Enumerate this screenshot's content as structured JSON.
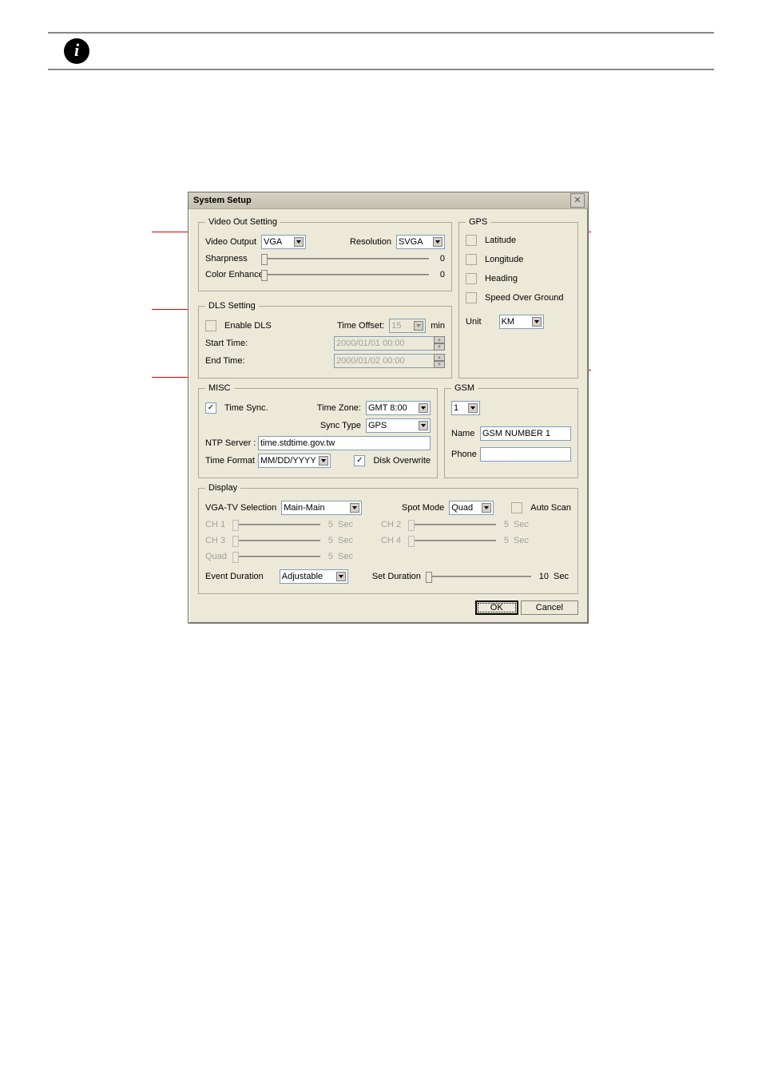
{
  "dialog": {
    "title": "System Setup",
    "video_out": {
      "legend": "Video Out Setting",
      "video_output_label": "Video Output",
      "video_output_value": "VGA",
      "resolution_label": "Resolution",
      "resolution_value": "SVGA",
      "sharpness_label": "Sharpness",
      "sharpness_value": "0",
      "color_enhance_label": "Color Enhance",
      "color_enhance_value": "0"
    },
    "gps": {
      "legend": "GPS",
      "latitude": "Latitude",
      "longitude": "Longitude",
      "heading": "Heading",
      "speed": "Speed Over Ground",
      "unit_label": "Unit",
      "unit_value": "KM"
    },
    "dls": {
      "legend": "DLS Setting",
      "enable": "Enable DLS",
      "time_offset_label": "Time Offset:",
      "time_offset_value": "15",
      "time_offset_unit": "min",
      "start_label": "Start Time:",
      "start_value": "2000/01/01 00:00",
      "end_label": "End Time:",
      "end_value": "2000/01/02 00:00"
    },
    "misc": {
      "legend": "MISC",
      "time_sync": "Time Sync.",
      "time_zone_label": "Time Zone:",
      "time_zone_value": "GMT 8:00",
      "sync_type_label": "Sync Type",
      "sync_type_value": "GPS",
      "ntp_label": "NTP Server :",
      "ntp_value": "time.stdtime.gov.tw",
      "time_format_label": "Time Format",
      "time_format_value": "MM/DD/YYYY",
      "disk_overwrite": "Disk Overwrite"
    },
    "gsm": {
      "legend": "GSM",
      "index": "1",
      "name_label": "Name",
      "name_value": "GSM NUMBER 1",
      "phone_label": "Phone",
      "phone_value": ""
    },
    "display": {
      "legend": "Display",
      "vga_tv_label": "VGA-TV Selection",
      "vga_tv_value": "Main-Main",
      "spot_mode_label": "Spot Mode",
      "spot_mode_value": "Quad",
      "auto_scan": "Auto Scan",
      "channels": [
        {
          "label": "CH 1",
          "value": "5",
          "unit": "Sec"
        },
        {
          "label": "CH 2",
          "value": "5",
          "unit": "Sec"
        },
        {
          "label": "CH 3",
          "value": "5",
          "unit": "Sec"
        },
        {
          "label": "CH 4",
          "value": "5",
          "unit": "Sec"
        }
      ],
      "quad_label": "Quad",
      "quad_value": "5",
      "quad_unit": "Sec",
      "event_duration_label": "Event Duration",
      "event_duration_value": "Adjustable",
      "set_duration_label": "Set Duration",
      "set_duration_value": "10",
      "set_duration_unit": "Sec"
    },
    "buttons": {
      "ok": "OK",
      "cancel": "Cancel"
    }
  }
}
